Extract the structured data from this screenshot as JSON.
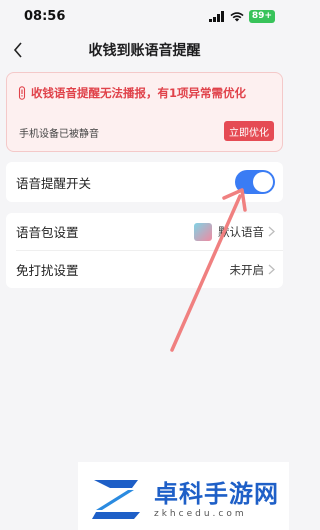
{
  "status_bar": {
    "time": "08:56",
    "battery": "89+"
  },
  "nav": {
    "title": "收钱到账语音提醒"
  },
  "warning": {
    "title": "收钱语音提醒无法播报，有1项异常需优化",
    "sub": "手机设备已被静音",
    "button_label": "立即优化",
    "accent": "#e54b54"
  },
  "settings": {
    "voice_toggle_label": "语音提醒开关",
    "voice_toggle_on": true,
    "voice_pack_label": "语音包设置",
    "voice_pack_value": "默认语音",
    "dnd_label": "免打扰设置",
    "dnd_value": "未开启"
  },
  "watermark": {
    "title": "卓科手游网",
    "url": "zkhcedu.com"
  },
  "colors": {
    "toggle_on": "#3a7cf4",
    "annotation_arrow": "#f08080"
  }
}
